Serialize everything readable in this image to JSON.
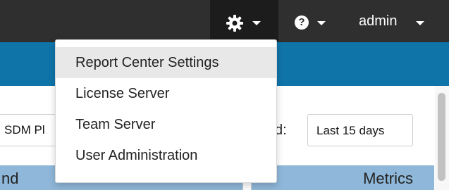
{
  "topbar": {
    "settings_icon": "gear-icon",
    "help_icon": "question-circle-icon",
    "help_glyph": "?",
    "user_label": "admin"
  },
  "dropdown": {
    "items": [
      {
        "label": "Report Center Settings",
        "active": true
      },
      {
        "label": "License Server",
        "active": false
      },
      {
        "label": "Team Server",
        "active": false
      },
      {
        "label": "User Administration",
        "active": false
      }
    ]
  },
  "filters": {
    "left_value": "SDM Pl",
    "period_label": "d:",
    "period_value": "Last 15 days"
  },
  "table": {
    "left_header": "nd",
    "right_header": "Metrics"
  },
  "colors": {
    "topbar": "#2f2f2f",
    "accent": "#0f74a8",
    "header_fill": "#8fb7d9"
  }
}
